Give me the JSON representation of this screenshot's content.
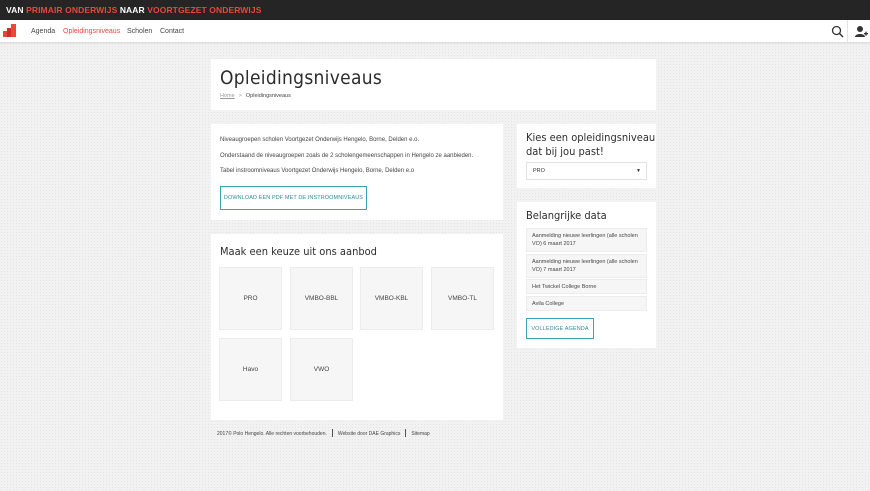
{
  "topbar": {
    "part1": "VAN ",
    "part2": "PRIMAIR ONDERWIJS",
    "part3": " NAAR ",
    "part4": "VOORTGEZET ONDERWIJS"
  },
  "nav": {
    "items": [
      {
        "label": "Agenda",
        "active": false
      },
      {
        "label": "Opleidingsniveaus",
        "active": true
      },
      {
        "label": "Scholen",
        "active": false
      },
      {
        "label": "Contact",
        "active": false
      }
    ]
  },
  "header": {
    "title": "Opleidingsniveaus",
    "breadcrumb": {
      "home": "Home",
      "separator": ">",
      "current": "Opleidingsniveaus"
    }
  },
  "intro": {
    "lines": [
      "Niveaugroepen scholen Voortgezet Onderwijs Hengelo, Borne, Delden e.o.",
      "Onderstaand de niveaugroepen zoals de 2 scholengemeenschappen in Hengelo ze aanbieden.",
      "Tabel instroomniveaus Voortgezet Onderwijs Hengelo, Borne, Delden e.o"
    ],
    "download_label": "DOWNLOAD EEN PDF MET DE INSTROOMNIVEAUS"
  },
  "offer": {
    "title": "Maak een keuze uit ons aanbod",
    "tiles": [
      "PRO",
      "VMBO-BBL",
      "VMBO-KBL",
      "VMBO-TL",
      "Havo",
      "VWO"
    ]
  },
  "level_picker": {
    "title_line1": "Kies een opleidingsniveau",
    "title_line2": "dat bij jou past!",
    "selected": "PRO"
  },
  "dates": {
    "title": "Belangrijke data",
    "items": [
      "Aanmelding nieuwe leerlingen (alle scholen VO) 6 maart 2017",
      "Aanmelding nieuwe leerlingen (alle scholen VO) 7 maart 2017",
      "Het Twickel College Borne",
      "Avila College"
    ],
    "agenda_label": "VOLLEDIGE AGENDA"
  },
  "footer": {
    "copyright": "2017© Polo Hengelo. Alle rechten voorbehouden.",
    "credit": "Website door DAE Graphics",
    "sitemap": "Sitemap"
  },
  "colors": {
    "accent": "#e8473c",
    "teal": "#3aa3b0",
    "dark": "#252525"
  },
  "icons": {
    "logo": "steps-logo-icon",
    "search": "search-icon",
    "user": "user-icon"
  }
}
